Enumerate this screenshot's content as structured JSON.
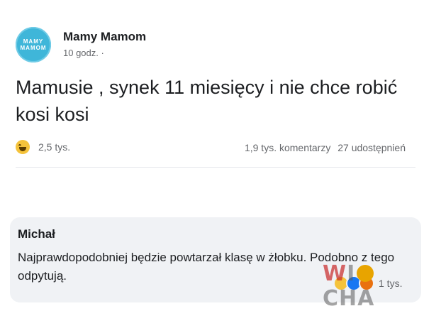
{
  "post": {
    "author": "Mamy Mamom",
    "avatar_text": [
      "MAMY",
      "MAMOM"
    ],
    "time": "10 godz. ·",
    "text": "Mamusie , synek 11 miesięcy i nie chce robić kosi kosi",
    "reaction_icon": "haha-emoji-icon",
    "reaction_count": "2,5 tys.",
    "comments": "1,9 tys. komentarzy",
    "shares": "27 udostępnień"
  },
  "comment": {
    "author": "Michał",
    "text": "Najprawdopodobniej będzie powtarzał klasę w żłobku. Podobno z tego odpytują.",
    "reaction_count": "1 tys."
  },
  "watermark": {
    "w": "W",
    "rest": "CHA",
    "i": "I"
  },
  "colors": {
    "avatar": "#3fb6d9",
    "text": "#1c1e21",
    "muted": "#65676b",
    "comment_bg": "#f0f2f5"
  }
}
